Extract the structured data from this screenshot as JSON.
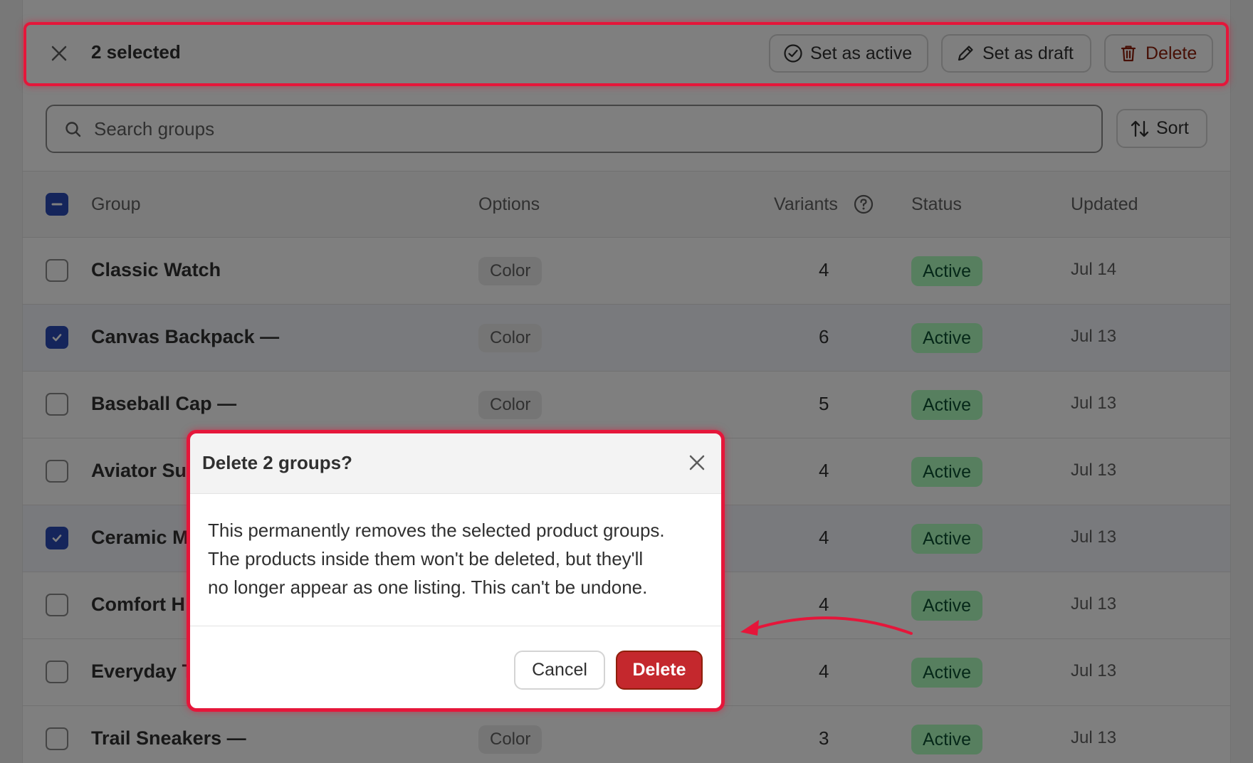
{
  "bulk_actions": {
    "selected_count_label": "2 selected",
    "set_active_label": "Set as active",
    "set_draft_label": "Set as draft",
    "delete_label": "Delete"
  },
  "search": {
    "placeholder": "Search groups",
    "value": ""
  },
  "sort": {
    "label": "Sort"
  },
  "table": {
    "headers": {
      "group": "Group",
      "options": "Options",
      "variants": "Variants",
      "status": "Status",
      "updated": "Updated"
    },
    "rows": [
      {
        "name": "Classic Watch",
        "option": "Color",
        "variants": "4",
        "status": "Active",
        "updated": "Jul 14",
        "selected": false
      },
      {
        "name": "Canvas Backpack —",
        "option": "Color",
        "variants": "6",
        "status": "Active",
        "updated": "Jul 13",
        "selected": true
      },
      {
        "name": "Baseball Cap —",
        "option": "Color",
        "variants": "5",
        "status": "Active",
        "updated": "Jul 13",
        "selected": false
      },
      {
        "name": "Aviator Su",
        "option": "",
        "variants": "4",
        "status": "Active",
        "updated": "Jul 13",
        "selected": false
      },
      {
        "name": "Ceramic M",
        "option": "",
        "variants": "4",
        "status": "Active",
        "updated": "Jul 13",
        "selected": true
      },
      {
        "name": "Comfort H",
        "option": "",
        "variants": "4",
        "status": "Active",
        "updated": "Jul 13",
        "selected": false
      },
      {
        "name": "Everyday T",
        "option": "",
        "variants": "4",
        "status": "Active",
        "updated": "Jul 13",
        "selected": false
      },
      {
        "name": "Trail Sneakers —",
        "option": "Color",
        "variants": "3",
        "status": "Active",
        "updated": "Jul 13",
        "selected": false
      }
    ]
  },
  "modal": {
    "title": "Delete 2 groups?",
    "body_lines": [
      "This permanently removes the selected product groups.",
      "The products inside them won't be deleted, but they'll",
      "no longer appear as one listing. This can't be undone."
    ],
    "cancel_label": "Cancel",
    "delete_label": "Delete"
  },
  "colors": {
    "highlight": "#e5163a",
    "destructive": "#c4282d",
    "checkbox_checked": "#2b4bb7",
    "status_active_bg": "#affebf"
  }
}
